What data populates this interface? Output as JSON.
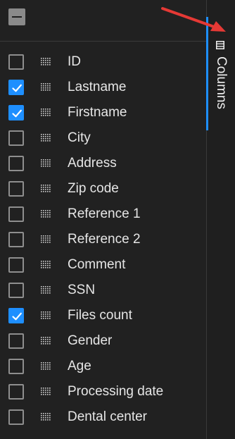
{
  "header": {
    "select_all_icon": "minus-checkbox-icon"
  },
  "columns": [
    {
      "label": "ID",
      "checked": false
    },
    {
      "label": "Lastname",
      "checked": true
    },
    {
      "label": "Firstname",
      "checked": true
    },
    {
      "label": "City",
      "checked": false
    },
    {
      "label": "Address",
      "checked": false
    },
    {
      "label": "Zip code",
      "checked": false
    },
    {
      "label": "Reference 1",
      "checked": false
    },
    {
      "label": "Reference 2",
      "checked": false
    },
    {
      "label": "Comment",
      "checked": false
    },
    {
      "label": "SSN",
      "checked": false
    },
    {
      "label": "Files count",
      "checked": true
    },
    {
      "label": "Gender",
      "checked": false
    },
    {
      "label": "Age",
      "checked": false
    },
    {
      "label": "Processing date",
      "checked": false
    },
    {
      "label": "Dental center",
      "checked": false
    }
  ],
  "side_tab": {
    "label": "Columns",
    "icon": "columns-icon"
  },
  "annotation": {
    "icon": "red-arrow-icon",
    "color": "#e53935"
  },
  "colors": {
    "accent": "#1e8fff",
    "background": "#212121",
    "text": "#e6e6e6"
  }
}
